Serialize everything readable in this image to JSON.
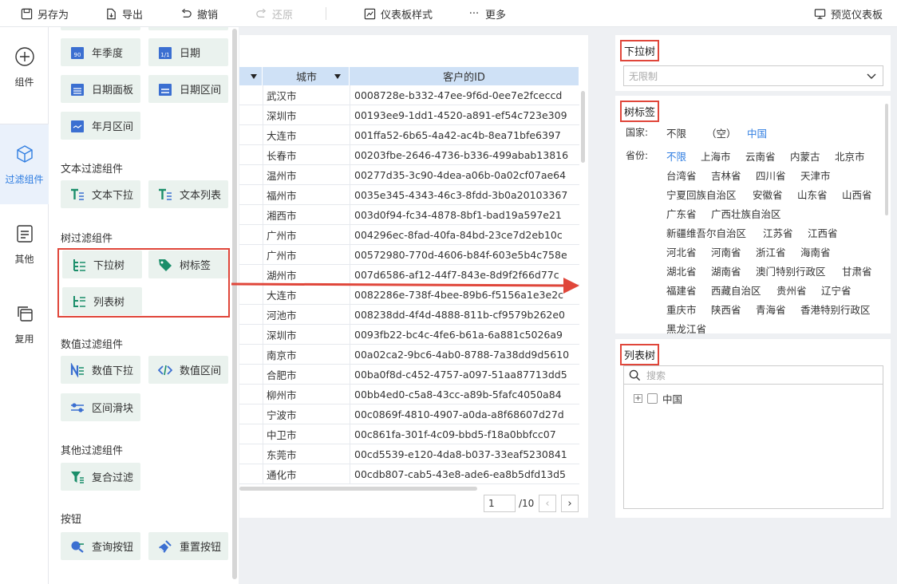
{
  "toolbar": {
    "save_as": "另存为",
    "export": "导出",
    "undo": "撤销",
    "redo": "还原",
    "dashboard_style": "仪表板样式",
    "more": "更多",
    "preview": "预览仪表板"
  },
  "rail": {
    "items": [
      {
        "label": "组件",
        "icon": "plus-circle-icon"
      },
      {
        "label": "过滤组件",
        "icon": "cube-icon",
        "active": true
      },
      {
        "label": "其他",
        "icon": "document-icon"
      },
      {
        "label": "复用",
        "icon": "copy-icon"
      }
    ]
  },
  "panel": {
    "date_items": [
      "年季度",
      "日期",
      "日期面板",
      "日期区间",
      "年月区间"
    ],
    "text_section": "文本过滤组件",
    "text_items": [
      "文本下拉",
      "文本列表"
    ],
    "tree_section": "树过滤组件",
    "tree_items": [
      "下拉树",
      "树标签",
      "列表树"
    ],
    "number_section": "数值过滤组件",
    "number_items": [
      "数值下拉",
      "数值区间",
      "区间滑块"
    ],
    "other_section": "其他过滤组件",
    "other_items": [
      "复合过滤"
    ],
    "button_section": "按钮",
    "button_items": [
      "查询按钮",
      "重置按钮"
    ]
  },
  "table": {
    "columns": [
      "城市",
      "客户的ID"
    ],
    "rows": [
      [
        "武汉市",
        "0008728e-b332-47ee-9f6d-0ee7e2fceccd"
      ],
      [
        "深圳市",
        "00193ee9-1dd1-4520-a891-ef54c723e309"
      ],
      [
        "大连市",
        "001ffa52-6b65-4a42-ac4b-8ea71bfe6397"
      ],
      [
        "长春市",
        "00203fbe-2646-4736-b336-499abab13816"
      ],
      [
        "温州市",
        "00277d35-3c90-4dea-a06b-0a02cf07ae64"
      ],
      [
        "福州市",
        "0035e345-4343-46c3-8fdd-3b0a20103367"
      ],
      [
        "湘西市",
        "003d0f94-fc34-4878-8bf1-bad19a597e21"
      ],
      [
        "广州市",
        "004296ec-8fad-40fa-84bd-23ce7d2eb10c"
      ],
      [
        "广州市",
        "00572980-770d-4606-b84f-603e5b4c758e"
      ],
      [
        "湖州市",
        "007d6586-af12-44f7-843e-8d9f2f66d77c"
      ],
      [
        "大连市",
        "0082286e-738f-4bee-89b6-f5156a1e3e2c"
      ],
      [
        "河池市",
        "008238dd-4f4d-4888-811b-cf9579b262e0"
      ],
      [
        "深圳市",
        "0093fb22-bc4c-4fe6-b61a-6a881c5026a9"
      ],
      [
        "南京市",
        "00a02ca2-9bc6-4ab0-8788-7a38dd9d5610"
      ],
      [
        "合肥市",
        "00ba0f8d-c452-4757-a097-51aa87713dd5"
      ],
      [
        "柳州市",
        "00bb4ed0-c5a8-43cc-a89b-5fafc4050a84"
      ],
      [
        "宁波市",
        "00c0869f-4810-4907-a0da-a8f68607d27d"
      ],
      [
        "中卫市",
        "00c861fa-301f-4c09-bbd5-f18a0bbfcc07"
      ],
      [
        "东莞市",
        "00cd5539-e120-4da8-b037-33eaf5230841"
      ],
      [
        "通化市",
        "00cdb807-cab5-43e8-ade6-ea8b5dfd13d5"
      ]
    ],
    "page": "1",
    "total": "/10"
  },
  "dropdown_tree": {
    "title": "下拉树",
    "placeholder": "无限制"
  },
  "tree_tags": {
    "title": "树标签",
    "country_label": "国家:",
    "country_tags": [
      "不限",
      "（空）",
      "中国"
    ],
    "province_label": "省份:",
    "province_tags": [
      "不限",
      "上海市",
      "云南省",
      "内蒙古",
      "北京市",
      "台湾省",
      "吉林省",
      "四川省",
      "天津市",
      "宁夏回族自治区",
      "安徽省",
      "山东省",
      "山西省",
      "广东省",
      "广西壮族自治区",
      "新疆维吾尔自治区",
      "江苏省",
      "江西省",
      "河北省",
      "河南省",
      "浙江省",
      "海南省",
      "湖北省",
      "湖南省",
      "澳门特别行政区",
      "甘肃省",
      "福建省",
      "西藏自治区",
      "贵州省",
      "辽宁省",
      "重庆市",
      "陕西省",
      "青海省",
      "香港特别行政区",
      "黑龙江省"
    ]
  },
  "list_tree": {
    "title": "列表树",
    "search_placeholder": "搜索",
    "root_node": "中国"
  },
  "colors": {
    "accent": "#2f7de1",
    "highlight_red": "#e0463a",
    "header_blue": "#cfe1f6",
    "component_bg": "#eaf2ee"
  }
}
